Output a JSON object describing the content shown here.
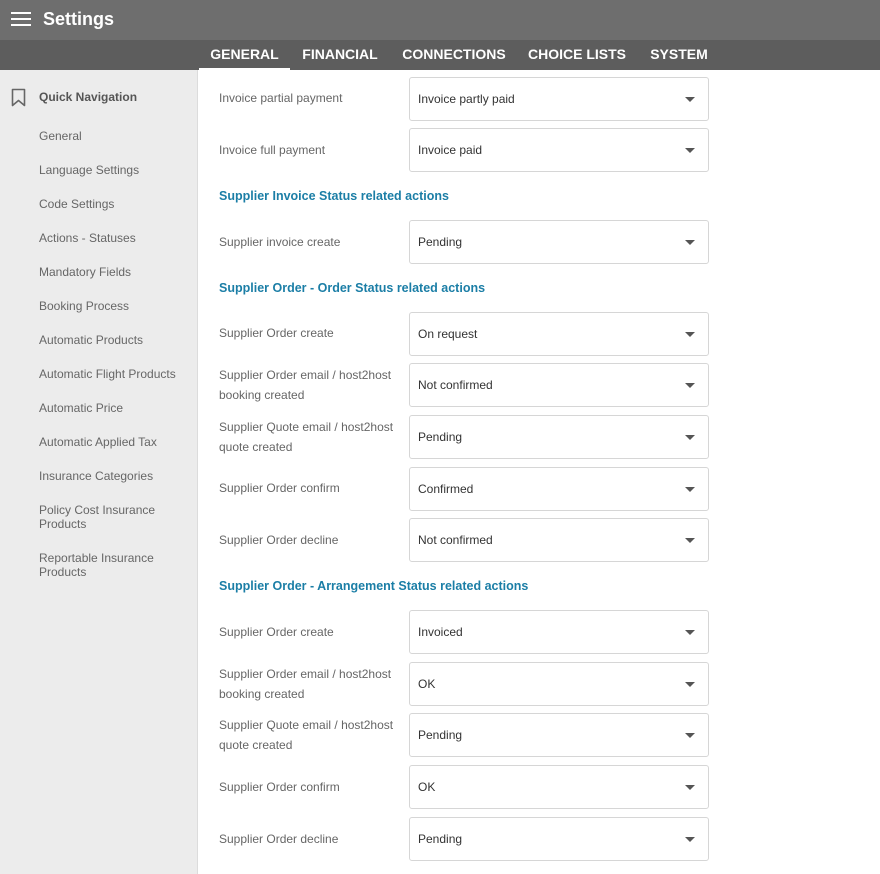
{
  "app": {
    "title": "Settings"
  },
  "tabs": [
    "GENERAL",
    "FINANCIAL",
    "CONNECTIONS",
    "CHOICE LISTS",
    "SYSTEM"
  ],
  "sidebar": {
    "heading": "Quick Navigation",
    "items": [
      "General",
      "Language Settings",
      "Code Settings",
      "Actions - Statuses",
      "Mandatory Fields",
      "Booking Process",
      "Automatic Products",
      "Automatic Flight Products",
      "Automatic Price",
      "Automatic Applied Tax",
      "Insurance Categories",
      "Policy Cost Insurance Products",
      "Reportable Insurance Products"
    ]
  },
  "invoice": {
    "rows": [
      {
        "label": "Invoice partial payment",
        "value": "Invoice partly paid"
      },
      {
        "label": "Invoice full payment",
        "value": "Invoice paid"
      }
    ]
  },
  "supplier_invoice": {
    "title": "Supplier Invoice Status related actions",
    "rows": [
      {
        "label": "Supplier invoice create",
        "value": "Pending"
      }
    ]
  },
  "order_status": {
    "title": "Supplier Order - Order Status related actions",
    "rows": [
      {
        "label": "Supplier Order create",
        "value": "On request"
      },
      {
        "label": "Supplier Order email / host2host booking created",
        "value": "Not confirmed"
      },
      {
        "label": "Supplier Quote email / host2host quote created",
        "value": "Pending"
      },
      {
        "label": "Supplier Order confirm",
        "value": "Confirmed"
      },
      {
        "label": "Supplier Order decline",
        "value": "Not confirmed"
      }
    ]
  },
  "arrangement_status": {
    "title": "Supplier Order - Arrangement Status related actions",
    "rows": [
      {
        "label": "Supplier Order create",
        "value": "Invoiced"
      },
      {
        "label": "Supplier Order email / host2host booking created",
        "value": "OK"
      },
      {
        "label": "Supplier Quote email / host2host quote created",
        "value": "Pending"
      },
      {
        "label": "Supplier Order confirm",
        "value": "OK"
      },
      {
        "label": "Supplier Order decline",
        "value": "Pending"
      }
    ]
  }
}
